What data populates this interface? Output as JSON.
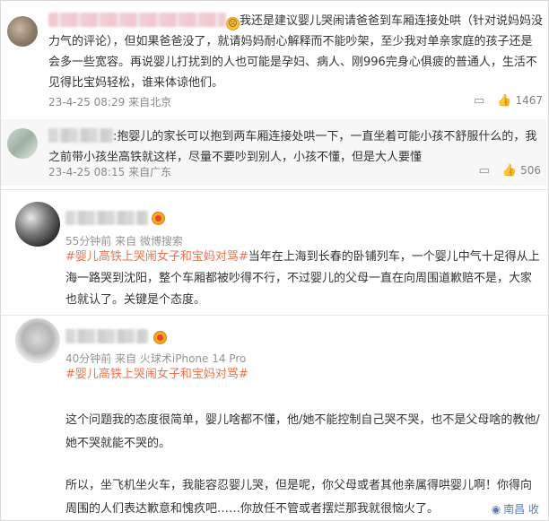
{
  "reply1": {
    "text": "我还是建议婴儿哭闹请爸爸到车厢连接处哄（针对说妈妈没力气的评论），但如果爸爸没了，就请妈妈耐心解释而不能吵架，至少我对单亲家庭的孩子还是会多一些宽容。再说婴儿打扰到的人也可能是孕妇、病人、刚996完身心俱疲的普通人，生活不见得比宝妈轻松，谁来体谅他们。",
    "emoji": "☹",
    "time": "23-4-25 08:29",
    "source": "来自北京",
    "likes": "1467"
  },
  "reply2": {
    "text": ":抱婴儿的家长可以抱到两车厢连接处哄一下，一直坐着可能小孩不舒服什么的，我之前带小孩坐高铁就这样，尽量不要吵到别人，小孩不懂，但是大人要懂",
    "time": "23-4-25 08:15",
    "source": "来自广东",
    "likes": "506"
  },
  "post1": {
    "meta": "55分钟前  来自 微博搜索",
    "tag": "#婴儿高铁上哭闹女子和宝妈对骂#",
    "text": "当年在上海到长春的卧铺列车，一个婴儿中气十足得从上海一路哭到沈阳，整个车厢都被吵得不行，不过婴儿的父母一直在向周围道歉赔不是，大家也就认了。关键是个态度。"
  },
  "post2": {
    "meta": "40分钟前  来自 火球术iPhone 14 Pro",
    "tag": "#婴儿高铁上哭闹女子和宝妈对骂#",
    "para1": "这个问题我的态度很简单，婴儿啥都不懂，他/她不能控制自己哭不哭，也不是父母啥的教他/她不哭就能不哭的。",
    "para2": "所以，坐飞机坐火车，我能容忍婴儿哭，但是呢，你父母或者其他亲属得哄婴儿啊！你得向周围的人们表达歉意和愧疚吧……你放任不管或者摆烂那我就很恼火了。",
    "location": "南昌 收"
  },
  "colors": {
    "tag": "#eb7350",
    "meta": "#888888",
    "link": "#5b7ba7"
  },
  "icons": [
    "emoji-sad-icon",
    "comment-icon",
    "like-icon",
    "vip-badge-icon",
    "location-pin-icon"
  ]
}
